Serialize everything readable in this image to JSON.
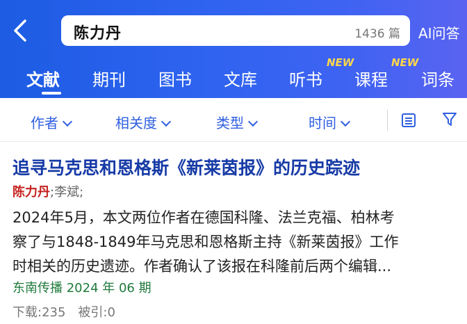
{
  "header": {
    "search": {
      "query": "陈力丹",
      "count": "1436 篇"
    },
    "ai_label": "AI问答",
    "tabs": [
      {
        "label": "文献",
        "active": true
      },
      {
        "label": "期刊"
      },
      {
        "label": "图书"
      },
      {
        "label": "文库"
      },
      {
        "label": "听书",
        "badge": "NEW"
      },
      {
        "label": "课程",
        "badge": "NEW"
      },
      {
        "label": "词条"
      }
    ]
  },
  "filters": {
    "items": [
      "作者",
      "相关度",
      "类型",
      "时间"
    ],
    "icons": [
      "list-icon",
      "filter-funnel-icon"
    ]
  },
  "results": [
    {
      "title": "追寻马克思和恩格斯《新莱茵报》的历史踪迹",
      "author_highlight": "陈力丹",
      "authors_rest": ";李斌;",
      "abstract_lines": [
        "2024年5月，本文两位作者在德国科隆、法兰克福、柏林考",
        "察了与1848-1849年马克思和恩格斯主持《新莱茵报》工作",
        "时相关的历史遗迹。作者确认了该报在科隆前后两个编辑..."
      ],
      "source": "东南传播 2024 年 06 期",
      "downloads": "下载:235",
      "citations": "被引:0"
    }
  ],
  "colors": {
    "header_start": "#1d5ce3",
    "header_end": "#5a63f1",
    "accent": "#2f5fe0",
    "title": "#163aa6",
    "author": "#c5221f",
    "source": "#1f7a3c",
    "badge": "#ffd84a"
  }
}
